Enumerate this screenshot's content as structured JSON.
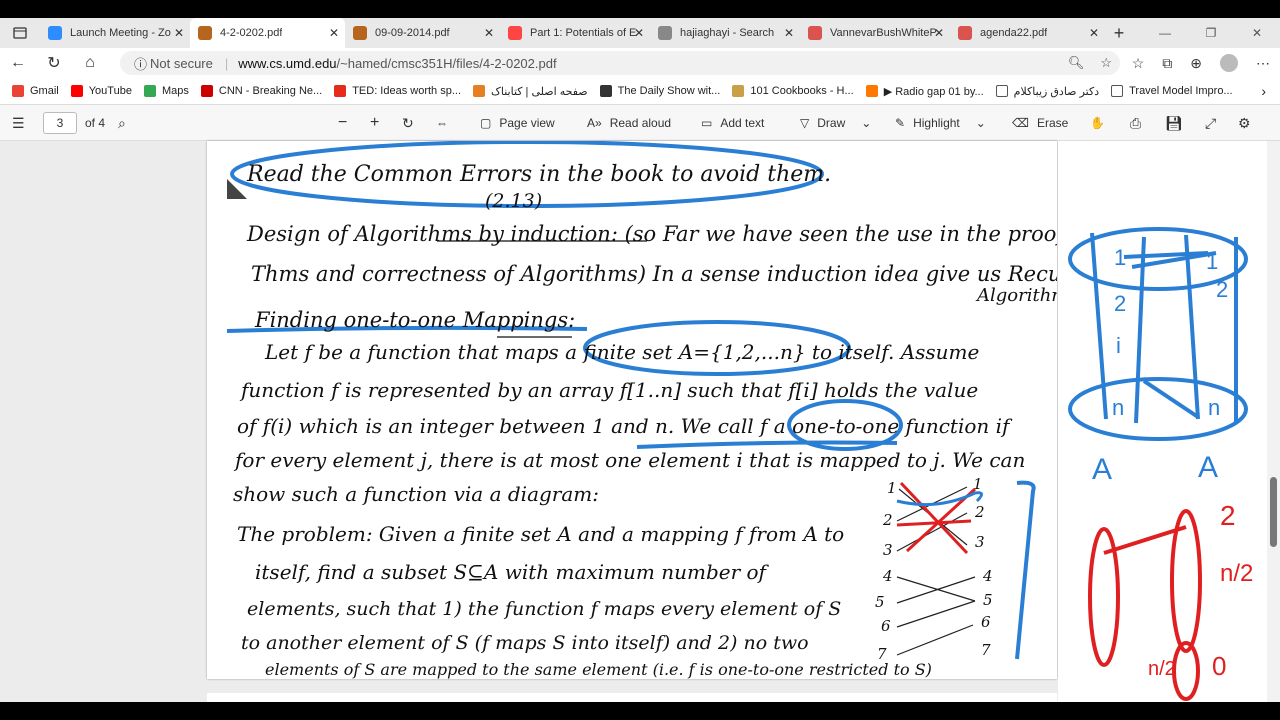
{
  "tabs": [
    {
      "title": "Launch Meeting - Zo",
      "favicon_color": "#2d8cff"
    },
    {
      "title": "4-2-0202.pdf",
      "favicon_color": "#b5651d"
    },
    {
      "title": "09-09-2014.pdf",
      "favicon_color": "#b5651d"
    },
    {
      "title": "Part 1: Potentials of E",
      "favicon_color": "#ff4444"
    },
    {
      "title": "hajiaghayi - Search",
      "favicon_color": "#888"
    },
    {
      "title": "VannevarBushWhiteP",
      "favicon_color": "#d9534f"
    },
    {
      "title": "agenda22.pdf",
      "favicon_color": "#d9534f"
    }
  ],
  "active_tab": 1,
  "address": {
    "not_secure": "Not secure",
    "domain": "www.cs.umd.edu",
    "path": "/~hamed/cmsc351H/files/4-2-0202.pdf"
  },
  "bookmarks": [
    {
      "label": "Gmail",
      "color": "#ea4335"
    },
    {
      "label": "YouTube",
      "color": "#ff0000"
    },
    {
      "label": "Maps",
      "color": "#34a853"
    },
    {
      "label": "CNN - Breaking Ne...",
      "color": "#cc0000"
    },
    {
      "label": "TED: Ideas worth sp...",
      "color": "#e62b1e"
    },
    {
      "label": "صفحه اصلی | کتابناک",
      "color": "#e67e22"
    },
    {
      "label": "The Daily Show wit...",
      "color": "#333333"
    },
    {
      "label": "101 Cookbooks - H...",
      "color": "#c8a048"
    },
    {
      "label": "▶ Radio gap 01 by...",
      "color": "#ff7700"
    },
    {
      "label": "دکتر صادق زیباکلام",
      "color": "#555555"
    },
    {
      "label": "Travel Model Impro...",
      "color": "#555555"
    }
  ],
  "pdf_toolbar": {
    "page_number": "3",
    "page_of": "of 4",
    "page_view": "Page view",
    "read_aloud": "Read aloud",
    "add_text": "Add text",
    "draw": "Draw",
    "highlight": "Highlight",
    "erase": "Erase"
  },
  "notes": {
    "line1": "Read the Common Errors in the book to avoid them.",
    "line1b": "(2.13)",
    "line2": "Design of Algorithms by induction: (so Far we have seen the use in the proof of",
    "line3": "Thms and correctness of Algorithms) In a sense induction idea give us Recursive",
    "line3b": "Algorithms",
    "line4": "Finding one-to-one Mappings:",
    "line5": "Let f be a function that maps a finite set A={1,2,...n} to itself. Assume",
    "line6": "function f is represented by an array f[1..n] such that f[i] holds the value",
    "line7": "of f(i) which is an integer between 1 and n. We call f a one-to-one function if",
    "line8": "for every element j, there is at most one element i that is mapped to j. We can",
    "line9": "show such a function via a diagram:",
    "line10": "The problem: Given a finite set A and a mapping f from A to",
    "line11": "itself, find a subset S⊆A with maximum number of",
    "line12": "elements, such that 1) the function f maps every element of S",
    "line13": "to another element of S (f maps S into itself) and 2) no two",
    "line14": "elements of S are mapped to the same element (i.e. f is one-to-one restricted to S)"
  },
  "diagram_labels": {
    "left": [
      "1",
      "2",
      "3",
      "4",
      "5",
      "6",
      "7"
    ],
    "right": [
      "1",
      "2",
      "3",
      "4",
      "5",
      "6",
      "7"
    ]
  },
  "whiteboard": {
    "blue_left": [
      "1",
      "2",
      "i",
      "n"
    ],
    "blue_right": [
      "1",
      "2",
      "n"
    ],
    "blue_bottom": [
      "A",
      "A"
    ],
    "red_labels": [
      "2",
      "n/2",
      "n/2",
      "0"
    ]
  }
}
